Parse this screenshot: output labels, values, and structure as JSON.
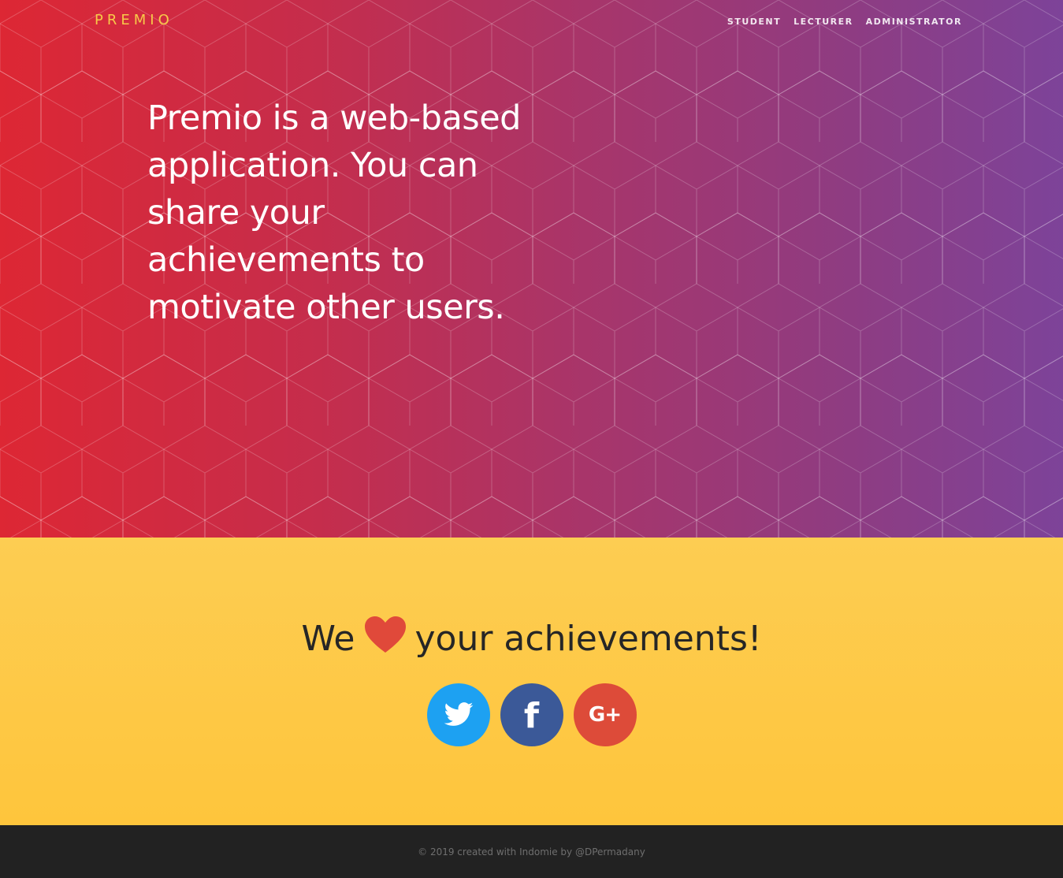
{
  "header": {
    "brand": "PREMIO",
    "nav": [
      "STUDENT",
      "LECTURER",
      "ADMINISTRATOR"
    ]
  },
  "hero": {
    "headline": "Premio is a web-based application. You can share your achievements to motivate other users."
  },
  "love": {
    "before": "We",
    "after": "your achievements!",
    "icon": "heart-icon"
  },
  "socials": [
    {
      "name": "twitter",
      "icon": "twitter-icon",
      "color": "#1da1f2"
    },
    {
      "name": "facebook",
      "icon": "facebook-icon",
      "color": "#3b5998",
      "label": "f"
    },
    {
      "name": "google-plus",
      "icon": "google-plus-icon",
      "color": "#dd4b39",
      "label": "G+"
    }
  ],
  "colors": {
    "brand": "#f7c948",
    "heart": "#e0493a",
    "gradient_start": "#dd2734",
    "gradient_end": "#7d4399",
    "section_yellow": "#fdc94a",
    "footer_bg": "#222222"
  },
  "footer": {
    "text": "© 2019 created with Indomie by @DPermadany"
  }
}
